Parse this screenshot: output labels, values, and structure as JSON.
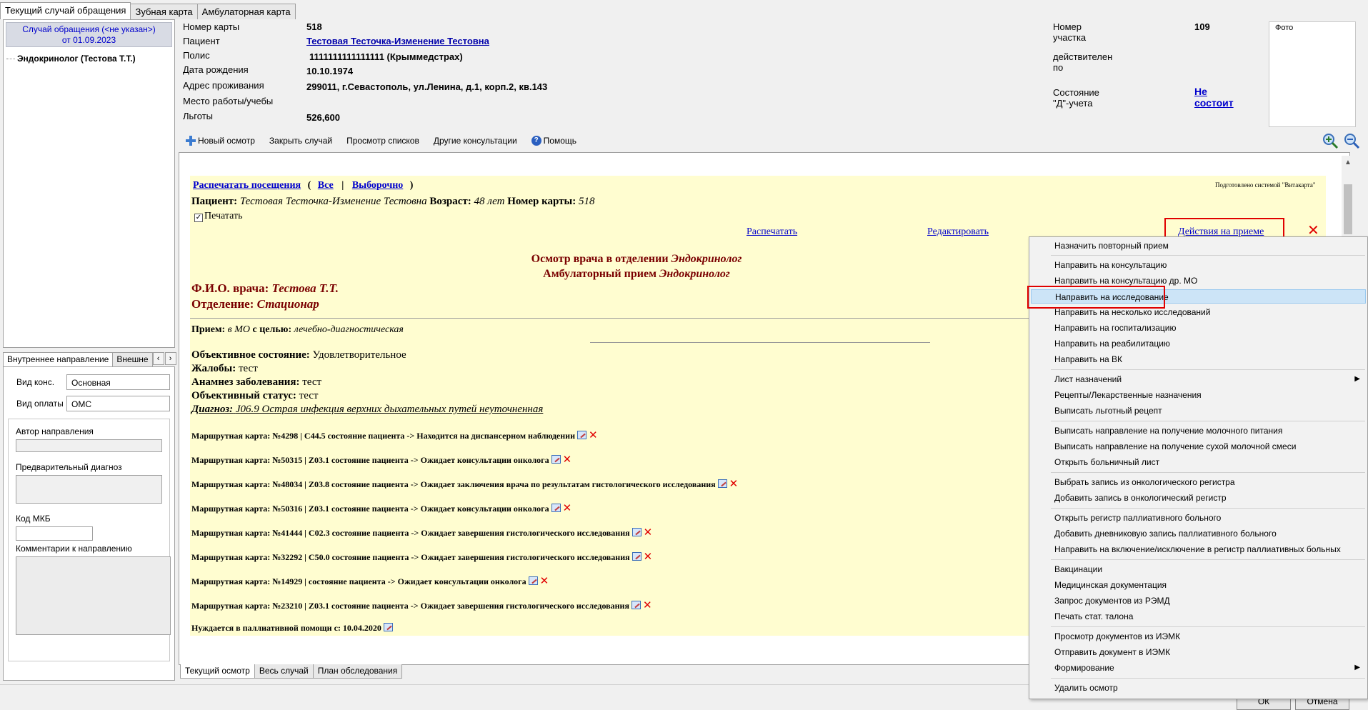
{
  "top_tabs": [
    "Текущий случай обращения",
    "Зубная карта",
    "Амбулаторная карта"
  ],
  "case": {
    "line1": "Случай обращения (<не указан>)",
    "line2": "от 01.09.2023",
    "tree_item": "Эндокринолог (Тестова Т.Т.)"
  },
  "dir_tabs": [
    "Внутреннее направление",
    "Внешне"
  ],
  "dir_form": {
    "vid_kons_label": "Вид конс.",
    "vid_kons_value": "Основная",
    "vid_oplaty_label": "Вид оплаты",
    "vid_oplaty_value": "ОМС",
    "author_label": "Автор направления",
    "prelim_diag_label": "Предварительный диагноз",
    "mkb_label": "Код МКБ",
    "comments_label": "Комментарии к направлению"
  },
  "patient": {
    "card_no_label": "Номер карты",
    "card_no": "518",
    "patient_label": "Пациент",
    "patient": "Тестовая Тесточка-Изменение Тестовна",
    "polis_label": "Полис",
    "polis": "1111111111111111 (Крыммедстрах)",
    "dob_label": "Дата рождения",
    "dob": "10.10.1974",
    "address_label": "Адрес проживания",
    "address": "299011, г.Севастополь, ул.Ленина, д.1, корп.2, кв.143",
    "work_label": "Место работы/учебы",
    "benefits_label": "Льготы",
    "benefits": "526,600",
    "district_label": "Номер участка",
    "district": "109",
    "valid_label": "действителен по",
    "d_status_label": "Состояние \"Д\"-учета",
    "d_status": "Не состоит",
    "photo_label": "Фото"
  },
  "toolbar": {
    "new_exam": "Новый осмотр",
    "close_case": "Закрыть случай",
    "view_lists": "Просмотр списков",
    "other_consults": "Другие консультации",
    "help": "Помощь"
  },
  "doc": {
    "print_visits": "Распечатать посещения",
    "all": "Все",
    "selective": "Выборочно",
    "prepared_by": "Подготовлено системой \"Витакарта\"",
    "patient_label": "Пациент:",
    "patient_name": "Тестовая Тесточка-Изменение Тестовна",
    "age_label": "Возраст:",
    "age": "48 лет",
    "card_label": "Номер карты:",
    "card_no": "518",
    "print_check": "Печатать",
    "print_link": "Распечатать",
    "edit_link": "Редактировать",
    "actions_link": "Действия на приеме",
    "exam_title_prefix": "Осмотр врача в отделении",
    "exam_title_dept": "Эндокринолог",
    "exam_subtitle_prefix": "Амбулаторный прием",
    "exam_subtitle_dept": "Эндокринолог",
    "doctor_label": "Ф.И.О. врача:",
    "doctor": "Тестова Т.Т.",
    "dept_label": "Отделение:",
    "dept": "Стационар",
    "reception_label": "Прием:",
    "reception_place": "в МО",
    "reception_goal_label": "с целью:",
    "reception_goal": "лечебно-диагностическая",
    "obj_state_label": "Объективное состояние:",
    "obj_state": "Удовлетворительное",
    "complaints_label": "Жалобы:",
    "complaints": "тест",
    "anamnesis_label": "Анамнез заболевания:",
    "anamnesis": "тест",
    "obj_status_label": "Объективный статус:",
    "obj_status": "тест",
    "diagnosis_label": "Диагноз:",
    "diagnosis": "J06.9 Острая инфекция верхних дыхательных путей неуточненная",
    "routes": [
      "Маршрутная карта: №4298 | C44.5 состояние пациента -> Находится на диспансерном наблюдении",
      "Маршрутная карта: №50315 | Z03.1 состояние пациента -> Ожидает консультации онколога",
      "Маршрутная карта: №48034 | Z03.8 состояние пациента -> Ожидает заключения врача по результатам гистологического исследования",
      "Маршрутная карта: №50316 | Z03.1 состояние пациента -> Ожидает консультации онколога",
      "Маршрутная карта: №41444 | C02.3 состояние пациента -> Ожидает завершения гистологического исследования",
      "Маршрутная карта: №32292 | C50.0 состояние пациента -> Ожидает завершения гистологического исследования",
      "Маршрутная карта: №14929 | состояние пациента -> Ожидает консультации онколога",
      "Маршрутная карта: №23210 | Z03.1 состояние пациента -> Ожидает завершения гистологического исследования"
    ],
    "palliative": "Нуждается в паллиативной помощи с: 10.04.2020"
  },
  "bottom_tabs": [
    "Текущий осмотр",
    "Весь случай",
    "План обследования"
  ],
  "bottom_buttons": [
    "ОК",
    "Отмена"
  ],
  "menu": {
    "items": [
      {
        "label": "Назначить повторный прием",
        "y": 0
      },
      {
        "label": "Направить на консультацию",
        "y": 1
      },
      {
        "label": "Направить на консультацию др. МО",
        "y": 2
      },
      {
        "label": "Направить на исследование",
        "y": 3,
        "selected": true
      },
      {
        "label": "Направить на несколько исследований",
        "y": 4
      },
      {
        "label": "Направить на госпитализацию",
        "y": 5
      },
      {
        "label": "Направить на реабилитацию",
        "y": 6
      },
      {
        "label": "Направить на ВК",
        "y": 7
      },
      {
        "label": "Лист назначений",
        "y": 8,
        "submenu": true
      },
      {
        "label": "Рецепты/Лекарственные назначения",
        "y": 9
      },
      {
        "label": "Выписать льготный рецепт",
        "y": 10
      },
      {
        "label": "Выписать направление на получение молочного питания",
        "y": 11
      },
      {
        "label": "Выписать направление на получение сухой молочной смеси",
        "y": 12
      },
      {
        "label": "Открыть больничный лист",
        "y": 13
      },
      {
        "label": "Выбрать запись из онкологического регистра",
        "y": 14
      },
      {
        "label": "Добавить запись в онкологический регистр",
        "y": 15
      },
      {
        "label": "Открыть регистр паллиативного больного",
        "y": 16
      },
      {
        "label": "Добавить дневниковую запись паллиативного больного",
        "y": 17
      },
      {
        "label": "Направить на включение/исключение в регистр паллиативных больных",
        "y": 18
      },
      {
        "label": "Вакцинации",
        "y": 19
      },
      {
        "label": "Медицинская документация",
        "y": 20
      },
      {
        "label": "Запрос документов из РЭМД",
        "y": 21
      },
      {
        "label": "Печать стат. талона",
        "y": 22
      },
      {
        "label": "Просмотр документов из ИЭМК",
        "y": 23
      },
      {
        "label": "Отправить документ в ИЭМК",
        "y": 24
      },
      {
        "label": "Формирование",
        "y": 25,
        "submenu": true
      },
      {
        "label": "Удалить осмотр",
        "y": 26
      }
    ]
  }
}
